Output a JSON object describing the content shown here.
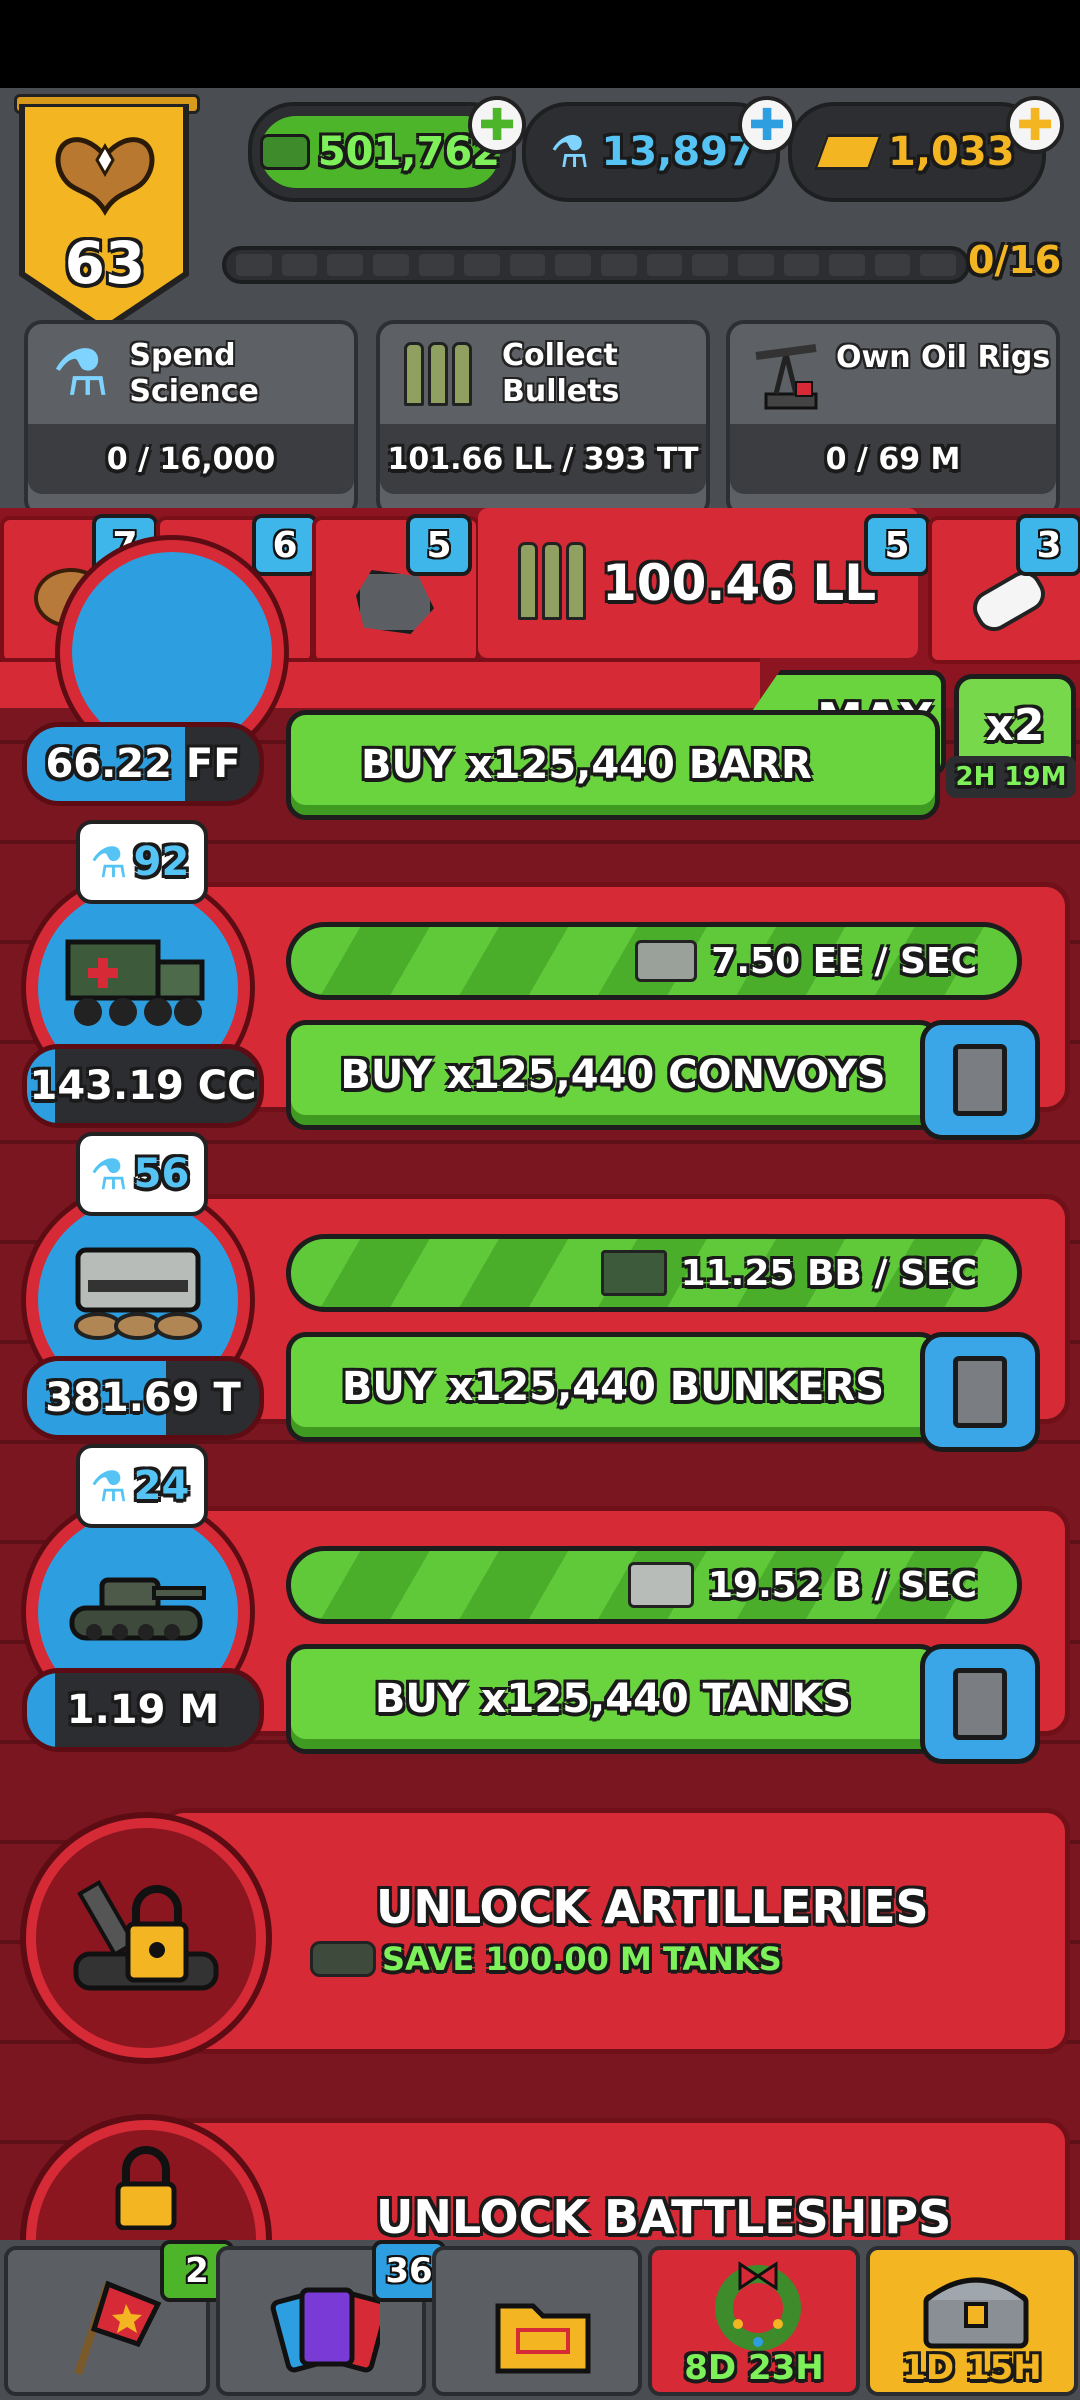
{
  "header": {
    "level": "63",
    "rank_progress": "0/16",
    "currencies": {
      "cash": "501,762",
      "science": "13,897",
      "gold": "1,033"
    }
  },
  "goals": [
    {
      "label_line1": "Spend",
      "label_line2": "Science",
      "progress": "0 / 16,000",
      "icon": "flask-icon"
    },
    {
      "label_line1": "Collect",
      "label_line2": "Bullets",
      "progress": "101.66 LL / 393 TT",
      "icon": "bullets-icon"
    },
    {
      "label_line1": "Own Oil Rigs",
      "label_line2": "",
      "progress": "0 / 69 M",
      "icon": "oil-rig-icon"
    }
  ],
  "tabs": [
    {
      "badge": "7",
      "icon": "potato-icon"
    },
    {
      "badge": "6",
      "icon": "land-flag-icon"
    },
    {
      "badge": "5",
      "icon": "ore-icon"
    },
    {
      "badge": "5",
      "icon": "bullets-icon",
      "value": "100.46 LL"
    },
    {
      "badge": "3",
      "icon": "pill-icon"
    }
  ],
  "buy_mode": {
    "label": "MAX",
    "multiplier": "x2",
    "timer": "2H 19M"
  },
  "units": [
    {
      "name": "barracks",
      "count": "66.22 FF",
      "buy_label": "BUY x125,440 BARR",
      "count_fill": 0.68
    },
    {
      "name": "convoys",
      "science": "92",
      "count": "143.19 CC",
      "rate": "7.50 EE / SEC",
      "buy_label": "BUY x125,440 CONVOYS",
      "count_fill": 0.12
    },
    {
      "name": "bunkers",
      "science": "56",
      "count": "381.69 T",
      "rate": "11.25 BB / SEC",
      "buy_label": "BUY x125,440 BUNKERS",
      "count_fill": 0.6
    },
    {
      "name": "tanks",
      "science": "24",
      "count": "1.19 M",
      "rate": "19.52 B / SEC",
      "buy_label": "BUY x125,440 TANKS",
      "count_fill": 0.12
    }
  ],
  "locked": [
    {
      "title": "UNLOCK ARTILLERIES",
      "requirement": "SAVE 100.00 M TANKS"
    },
    {
      "title": "UNLOCK BATTLESHIPS"
    }
  ],
  "bottom_nav": [
    {
      "icon": "flag-icon",
      "badge": "2"
    },
    {
      "icon": "cards-icon",
      "badge": "36"
    },
    {
      "icon": "folder-icon"
    },
    {
      "icon": "wreath-icon",
      "timer": "8D 23H"
    },
    {
      "icon": "chest-icon",
      "timer": "1D 15H"
    }
  ],
  "colors": {
    "accent_red": "#d62a36",
    "green": "#6ad43e",
    "blue": "#2d9ee0",
    "gold": "#f3b622"
  }
}
